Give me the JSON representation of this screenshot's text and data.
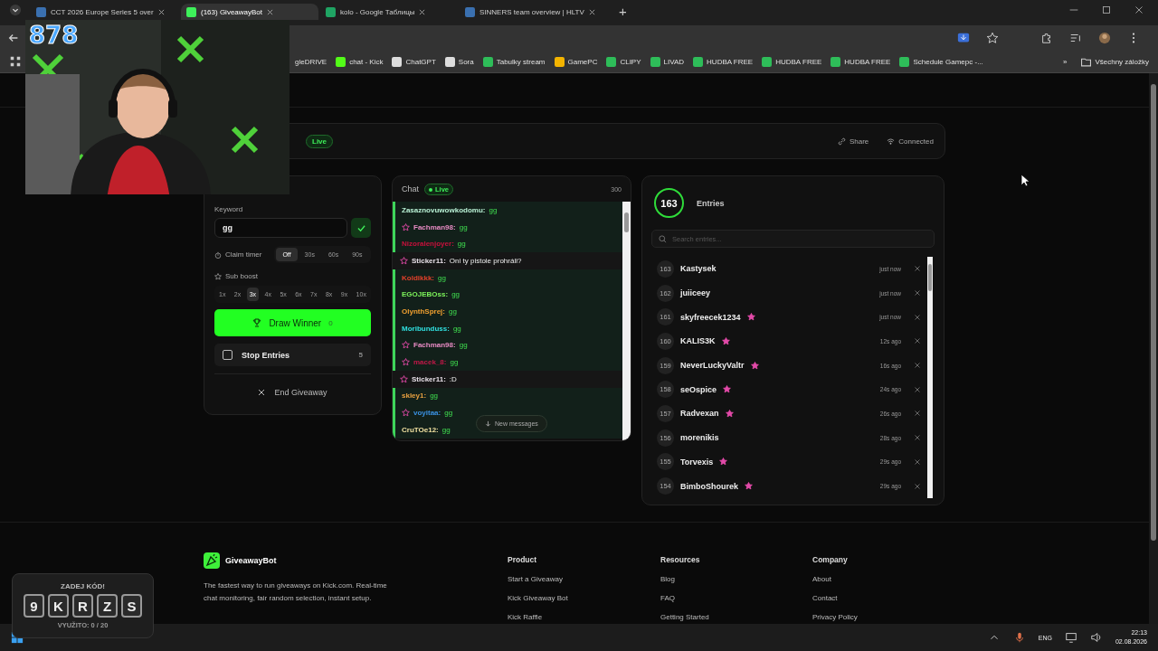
{
  "browser": {
    "tabs": [
      {
        "title": "CCT 2026 Europe Series 5 over",
        "selected": false
      },
      {
        "title": "(163) GiveawayBot",
        "selected": true
      },
      {
        "title": "kolo - Google Таблицы",
        "selected": false
      },
      {
        "title": "SINNERS team overview | HLTV",
        "selected": false
      }
    ],
    "new_tab": "+",
    "bookmarks": [
      "gleDRIVE",
      "chat - Kick",
      "ChatGPT",
      "Sora",
      "Tabulky stream",
      "GamePC",
      "CLIPY",
      "LIVAD",
      "HUDBA FREE",
      "HUDBA FREE",
      "HUDBA FREE",
      "Schedule Gamepc -..."
    ],
    "more_bookmarks": "»",
    "all_bookmarks": "Všechny záložky"
  },
  "stream_overlay": {
    "viewer_count": "878",
    "code_widget": {
      "title": "ZADEJ KÓD!",
      "code": [
        "9",
        "K",
        "R",
        "Z",
        "S"
      ],
      "usage": "VYUŽITO: 0 / 20"
    }
  },
  "header": {
    "badge": "Live",
    "actions": [
      "Share",
      "Connected"
    ]
  },
  "settings": {
    "keyword_label": "Keyword",
    "keyword": "gg",
    "claim_timer": {
      "label": "Claim timer",
      "options": [
        {
          "label": "Off",
          "selected": true
        },
        {
          "label": "30s",
          "selected": false
        },
        {
          "label": "60s",
          "selected": false
        },
        {
          "label": "90s",
          "selected": false
        }
      ]
    },
    "sub_boost": {
      "label": "Sub boost",
      "options": [
        {
          "label": "1x",
          "selected": false
        },
        {
          "label": "2x",
          "selected": false
        },
        {
          "label": "3x",
          "selected": true
        },
        {
          "label": "4x",
          "selected": false
        },
        {
          "label": "5x",
          "selected": false
        },
        {
          "label": "6x",
          "selected": false
        },
        {
          "label": "7x",
          "selected": false
        },
        {
          "label": "8x",
          "selected": false
        },
        {
          "label": "9x",
          "selected": false
        },
        {
          "label": "10x",
          "selected": false
        }
      ]
    },
    "draw_button": {
      "label": "Draw Winner",
      "count": "0"
    },
    "stop_entries": {
      "label": "Stop Entries",
      "checked": false,
      "count": "5"
    },
    "end_button": "End Giveaway"
  },
  "chat": {
    "title": "Chat",
    "badge": "Live",
    "count": "300",
    "separator": ":",
    "new_messages": "New messages",
    "messages": [
      {
        "user": "Zasaznovuwowkodomu",
        "color": "#b8f0d4",
        "text": "gg",
        "matched": true,
        "subscriber": false
      },
      {
        "user": "Fachman98",
        "color": "#e88bc4",
        "text": "gg",
        "matched": true,
        "subscriber": true
      },
      {
        "user": "Nizoralenjoyer",
        "color": "#c8103c",
        "text": "gg",
        "matched": true,
        "subscriber": false
      },
      {
        "user": "Sticker11",
        "color": "#e8e0e8",
        "text": "Oni ty pistole prohráli?",
        "matched": false,
        "subscriber": true
      },
      {
        "user": "Koldikkk",
        "color": "#e0402a",
        "text": "gg",
        "matched": true,
        "subscriber": false
      },
      {
        "user": "EGOJEBOss",
        "color": "#7cf25a",
        "text": "gg",
        "matched": true,
        "subscriber": false
      },
      {
        "user": "OlynthSprej",
        "color": "#f0a030",
        "text": "gg",
        "matched": true,
        "subscriber": false
      },
      {
        "user": "Moribunduss",
        "color": "#30e0e0",
        "text": "gg",
        "matched": true,
        "subscriber": false
      },
      {
        "user": "Fachman98",
        "color": "#e88bc4",
        "text": "gg",
        "matched": true,
        "subscriber": true
      },
      {
        "user": "macek_8",
        "color": "#c01848",
        "text": "gg",
        "matched": true,
        "subscriber": true
      },
      {
        "user": "Sticker11",
        "color": "#e8e0e8",
        "text": ":D",
        "matched": false,
        "subscriber": true
      },
      {
        "user": "skley1",
        "color": "#e8a040",
        "text": "gg",
        "matched": true,
        "subscriber": false
      },
      {
        "user": "voyitaa",
        "color": "#3a90e0",
        "text": "gg",
        "matched": true,
        "subscriber": true
      },
      {
        "user": "CruTOe12",
        "color": "#f0e0a0",
        "text": "gg",
        "matched": true,
        "subscriber": false
      }
    ]
  },
  "entries": {
    "count": "163",
    "title": "Entries",
    "search_placeholder": "Search entries...",
    "items": [
      {
        "number": "163",
        "name": "Kastysek",
        "subscriber": false,
        "time": "just now"
      },
      {
        "number": "162",
        "name": "juiiceey",
        "subscriber": false,
        "time": "just now"
      },
      {
        "number": "161",
        "name": "skyfreecek1234",
        "subscriber": true,
        "time": "just now"
      },
      {
        "number": "160",
        "name": "KALIS3K",
        "subscriber": true,
        "time": "12s ago"
      },
      {
        "number": "159",
        "name": "NeverLuckyValtr",
        "subscriber": true,
        "time": "16s ago"
      },
      {
        "number": "158",
        "name": "seOspice",
        "subscriber": true,
        "time": "24s ago"
      },
      {
        "number": "157",
        "name": "Radvexan",
        "subscriber": true,
        "time": "26s ago"
      },
      {
        "number": "156",
        "name": "morenikis",
        "subscriber": false,
        "time": "28s ago"
      },
      {
        "number": "155",
        "name": "Torvexis",
        "subscriber": true,
        "time": "29s ago"
      },
      {
        "number": "154",
        "name": "BimboShourek",
        "subscriber": true,
        "time": "29s ago"
      }
    ]
  },
  "footer": {
    "brand": "GiveawayBot",
    "description": "The fastest way to run giveaways on Kick.com. Real-time chat monitoring, fair random selection, instant setup.",
    "columns": [
      {
        "title": "Product",
        "links": [
          "Start a Giveaway",
          "Kick Giveaway Bot",
          "Kick Raffle"
        ]
      },
      {
        "title": "Resources",
        "links": [
          "Blog",
          "FAQ",
          "Getting Started"
        ]
      },
      {
        "title": "Company",
        "links": [
          "About",
          "Contact",
          "Privacy Policy"
        ]
      }
    ]
  },
  "taskbar": {
    "language": "ENG",
    "time": "22:13",
    "date": "02.08.2026"
  }
}
